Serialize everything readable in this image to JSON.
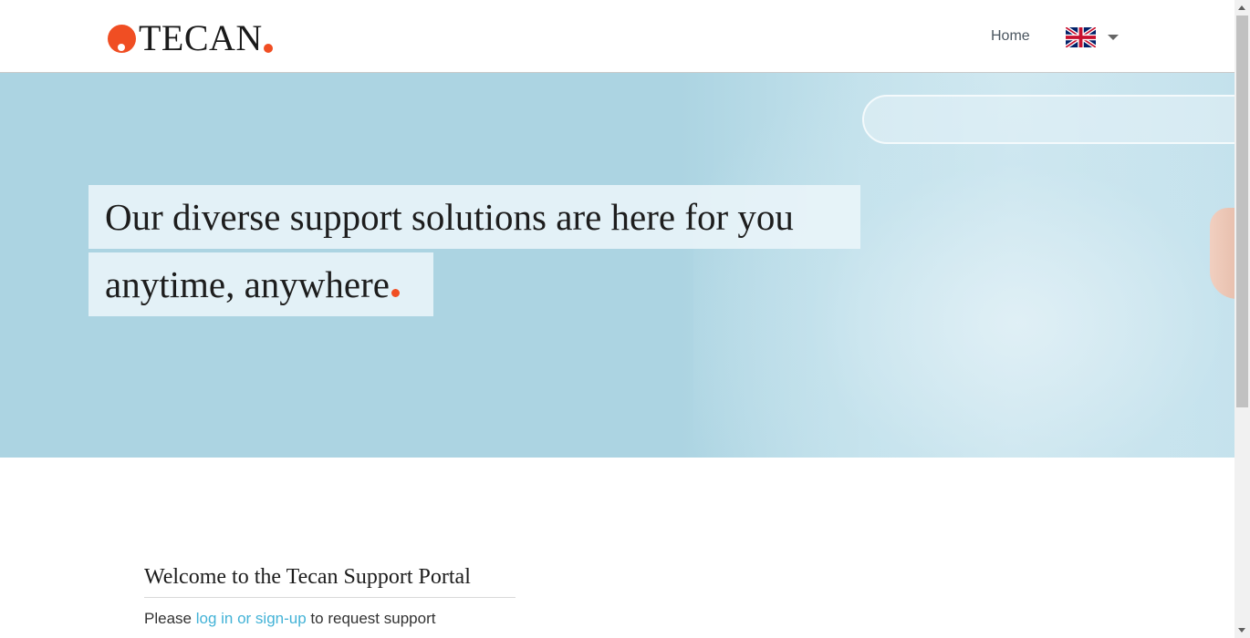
{
  "header": {
    "logo_text": "TECAN",
    "nav_home": "Home",
    "language_icon": "uk-flag-icon",
    "brand_color": "#f04e23"
  },
  "hero": {
    "line1": "Our diverse support solutions are here for you",
    "line2": "anytime, anywhere"
  },
  "welcome": {
    "title": "Welcome to the Tecan Support Portal",
    "prefix": "Please",
    "link": "log in or sign-up",
    "suffix": "to request support",
    "link_color": "#44b3d7"
  }
}
